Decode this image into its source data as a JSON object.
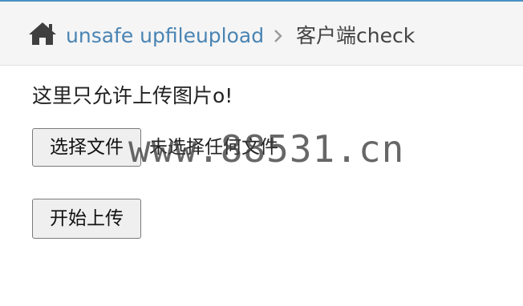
{
  "breadcrumb": {
    "home_icon": "home-icon",
    "link_label": "unsafe upfileupload",
    "separator_icon": "chevron-right-icon",
    "current_label": "客户端check"
  },
  "main": {
    "notice_text": "这里只允许上传图片o!",
    "file_input": {
      "button_label": "选择文件",
      "status_text": "未选择任何文件"
    },
    "upload_button_label": "开始上传"
  },
  "watermark": {
    "text": "www.88531.cn"
  },
  "colors": {
    "link": "#4a84b3",
    "breadcrumb_bg": "#f5f5f5",
    "accent_top_border": "#4a90c4",
    "button_bg": "#efefef"
  }
}
